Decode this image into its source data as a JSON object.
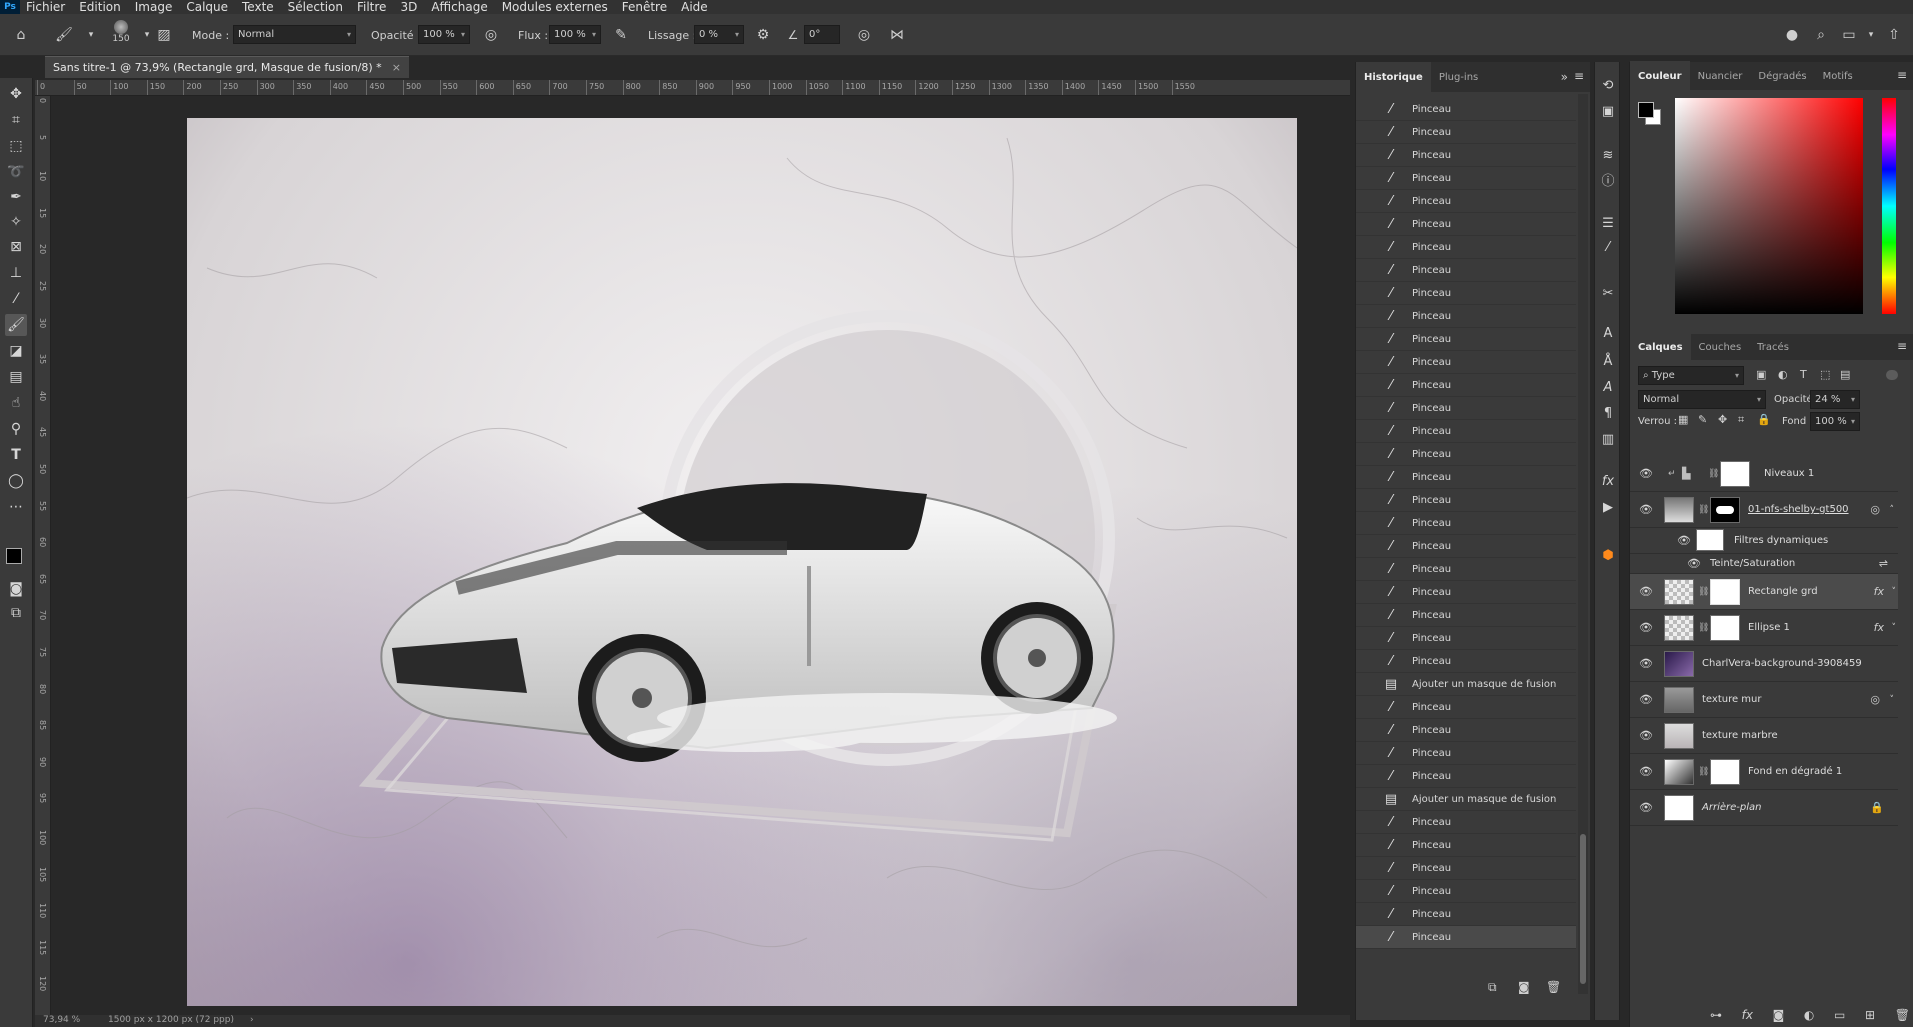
{
  "app": {
    "logo": "Ps"
  },
  "menu": [
    "Fichier",
    "Edition",
    "Image",
    "Calque",
    "Texte",
    "Sélection",
    "Filtre",
    "3D",
    "Affichage",
    "Modules externes",
    "Fenêtre",
    "Aide"
  ],
  "options": {
    "brush_size": "150",
    "mode_label": "Mode :",
    "mode_value": "Normal",
    "opacity_label": "Opacité :",
    "opacity_value": "100 %",
    "flow_label": "Flux :",
    "flow_value": "100 %",
    "smoothing_label": "Lissage :",
    "smoothing_value": "0 %",
    "angle_value": "0°"
  },
  "document": {
    "tab_title": "Sans titre-1 @ 73,9% (Rectangle grd, Masque de fusion/8) *",
    "close": "×",
    "status_zoom": "73,94 %",
    "status_info": "1500 px x 1200 px (72 ppp)"
  },
  "ruler": {
    "h_ticks": [
      "0",
      "50",
      "100",
      "150",
      "200",
      "250",
      "300",
      "350",
      "400",
      "450",
      "500",
      "550",
      "600",
      "650",
      "700",
      "750",
      "800",
      "850",
      "900",
      "950",
      "1000",
      "1050",
      "1100",
      "1150",
      "1200",
      "1250",
      "1300",
      "1350",
      "1400",
      "1450",
      "1500",
      "1550"
    ],
    "v_ticks": [
      "0",
      "5",
      "10",
      "15",
      "20",
      "25",
      "30",
      "35",
      "40",
      "45",
      "50",
      "55",
      "60",
      "65",
      "70",
      "75",
      "80",
      "85",
      "90",
      "95",
      "100",
      "105",
      "110",
      "115",
      "120"
    ]
  },
  "history": {
    "tabs": [
      "Historique",
      "Plug-ins"
    ],
    "items": [
      "Pinceau",
      "Pinceau",
      "Pinceau",
      "Pinceau",
      "Pinceau",
      "Pinceau",
      "Pinceau",
      "Pinceau",
      "Pinceau",
      "Pinceau",
      "Pinceau",
      "Pinceau",
      "Pinceau",
      "Pinceau",
      "Pinceau",
      "Pinceau",
      "Pinceau",
      "Pinceau",
      "Pinceau",
      "Pinceau",
      "Pinceau",
      "Pinceau",
      "Pinceau",
      "Pinceau",
      "Pinceau",
      "Ajouter un masque de fusion",
      "Pinceau",
      "Pinceau",
      "Pinceau",
      "Pinceau",
      "Ajouter un masque de fusion",
      "Pinceau",
      "Pinceau",
      "Pinceau",
      "Pinceau",
      "Pinceau",
      "Pinceau"
    ]
  },
  "color_panel": {
    "tabs": [
      "Couleur",
      "Nuancier",
      "Dégradés",
      "Motifs"
    ]
  },
  "layers_panel": {
    "tabs": [
      "Calques",
      "Couches",
      "Tracés"
    ],
    "filter_value": "Type",
    "blend_mode": "Normal",
    "opacity_label": "Opacité :",
    "opacity_value": "24 %",
    "lock_label": "Verrou :",
    "fill_label": "Fond :",
    "fill_value": "100 %",
    "layers": [
      {
        "name": "Niveaux 1"
      },
      {
        "name": "01-nfs-shelby-gt500"
      },
      {
        "name": "Filtres dynamiques"
      },
      {
        "name": "Teinte/Saturation"
      },
      {
        "name": "Rectangle grd"
      },
      {
        "name": "Ellipse 1"
      },
      {
        "name": "CharlVera-background-3908459"
      },
      {
        "name": "texture mur"
      },
      {
        "name": "texture marbre"
      },
      {
        "name": "Fond en dégradé 1"
      },
      {
        "name": "Arrière-plan"
      }
    ]
  },
  "colors": {
    "accent": "#31a8ff",
    "panel_bg": "#3a3a3a",
    "workspace_bg": "#282828"
  }
}
